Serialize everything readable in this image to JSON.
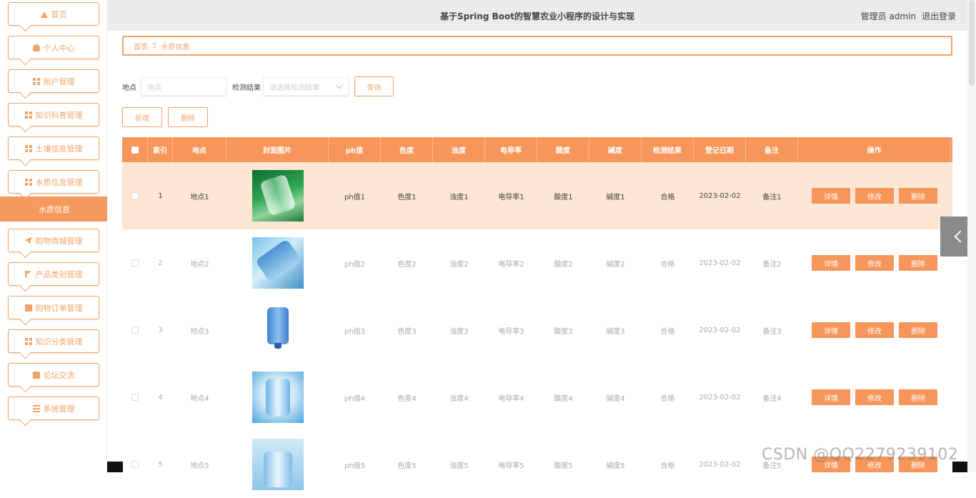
{
  "app": {
    "title": "基于Spring Boot的智慧农业小程序的设计与实现",
    "user_label": "管理员 admin",
    "logout_label": "退出登录"
  },
  "sidebar": {
    "items": [
      {
        "label": "首页",
        "icon": "home-icon"
      },
      {
        "label": "个人中心",
        "icon": "user-icon"
      },
      {
        "label": "用户管理",
        "icon": "grid-icon"
      },
      {
        "label": "知识科普管理",
        "icon": "grid-icon"
      },
      {
        "label": "土壤信息管理",
        "icon": "grid-icon"
      },
      {
        "label": "水质信息管理",
        "icon": "grid-icon"
      },
      {
        "label": "购物商城管理",
        "icon": "send-icon"
      },
      {
        "label": "产品类别管理",
        "icon": "flag-icon"
      },
      {
        "label": "购物订单管理",
        "icon": "clipboard-icon"
      },
      {
        "label": "知识分类管理",
        "icon": "grid-icon"
      },
      {
        "label": "论坛交流",
        "icon": "clipboard-icon"
      },
      {
        "label": "系统管理",
        "icon": "list-icon"
      }
    ],
    "active_label": "水质信息"
  },
  "breadcrumb": {
    "home": "首页",
    "separator": "Ξ",
    "current": "水质信息"
  },
  "search": {
    "location_label": "地点",
    "location_placeholder": "地点",
    "result_label": "检测结果",
    "result_placeholder": "请选择检测结果",
    "query_label": "查询"
  },
  "actions": {
    "add_label": "新增",
    "delete_label": "删除"
  },
  "table": {
    "headers": [
      "索引",
      "地点",
      "封面图片",
      "ph值",
      "色度",
      "浊度",
      "电导率",
      "酸度",
      "碱度",
      "检测结果",
      "登记日期",
      "备注",
      "操作"
    ],
    "row_buttons": {
      "detail": "详情",
      "edit": "修改",
      "delete": "删除"
    },
    "rows": [
      {
        "index": "1",
        "location": "地点1",
        "ph": "ph值1",
        "color": "色度1",
        "turbidity": "浊度1",
        "conductivity": "电导率1",
        "acidity": "酸度1",
        "alkalinity": "碱度1",
        "result": "合格",
        "date": "2023-02-02",
        "note": "备注1",
        "image": "water-bottle-image"
      },
      {
        "index": "2",
        "location": "地点2",
        "ph": "ph值2",
        "color": "色度2",
        "turbidity": "浊度2",
        "conductivity": "电导率2",
        "acidity": "酸度2",
        "alkalinity": "碱度2",
        "result": "合格",
        "date": "2023-02-02",
        "note": "备注2",
        "image": "water-bottle-image"
      },
      {
        "index": "3",
        "location": "地点3",
        "ph": "ph值3",
        "color": "色度3",
        "turbidity": "浊度3",
        "conductivity": "电导率3",
        "acidity": "酸度3",
        "alkalinity": "碱度3",
        "result": "合格",
        "date": "2023-02-02",
        "note": "备注3",
        "image": "water-bottle-image"
      },
      {
        "index": "4",
        "location": "地点4",
        "ph": "ph值4",
        "color": "色度4",
        "turbidity": "浊度4",
        "conductivity": "电导率4",
        "acidity": "酸度4",
        "alkalinity": "碱度4",
        "result": "合格",
        "date": "2023-02-02",
        "note": "备注4",
        "image": "water-bottle-image"
      },
      {
        "index": "5",
        "location": "地点5",
        "ph": "ph值5",
        "color": "色度5",
        "turbidity": "浊度5",
        "conductivity": "电导率5",
        "acidity": "酸度5",
        "alkalinity": "碱度5",
        "result": "合格",
        "date": "2023-02-02",
        "note": "备注5",
        "image": "water-bottle-image"
      }
    ]
  },
  "watermark": "CSDN @QQ2279239102",
  "colors": {
    "accent": "#f7965a",
    "accent_border": "#f0a467",
    "row_highlight": "#fde6d4",
    "topbar": "#ebebeb"
  }
}
